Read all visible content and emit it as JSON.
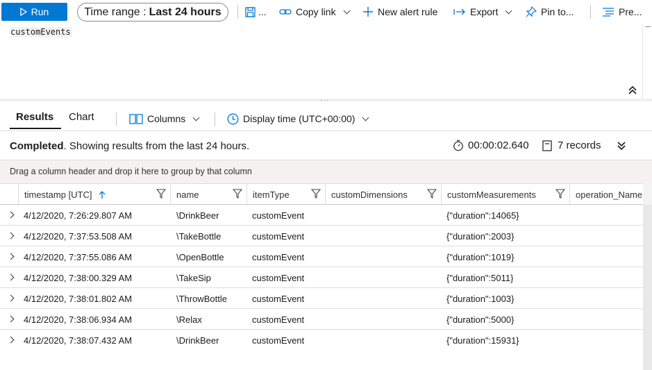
{
  "toolbar": {
    "run_label": "Run",
    "time_range_prefix": "Time range :",
    "time_range_value": "Last 24 hours",
    "save_label": "...",
    "copy_link_label": "Copy link",
    "new_alert_label": "New alert rule",
    "export_label": "Export",
    "pin_label": "Pin to...",
    "prettify_label": "Pre..."
  },
  "editor": {
    "query": "customEvents"
  },
  "results": {
    "tab_results": "Results",
    "tab_chart": "Chart",
    "columns_label": "Columns",
    "display_time_label": "Display time (UTC+00:00)",
    "status_bold": "Completed",
    "status_rest": ". Showing results from the last 24 hours.",
    "duration": "00:00:02.640",
    "records": "7 records",
    "group_hint": "Drag a column header and drop it here to group by that column"
  },
  "grid": {
    "columns": [
      "timestamp [UTC]",
      "name",
      "itemType",
      "customDimensions",
      "customMeasurements",
      "operation_Name"
    ],
    "rows": [
      {
        "timestamp": "4/12/2020, 7:26:29.807 AM",
        "name": "\\DrinkBeer",
        "itemType": "customEvent",
        "customDimensions": "",
        "customMeasurements": "{\"duration\":14065}"
      },
      {
        "timestamp": "4/12/2020, 7:37:53.508 AM",
        "name": "\\TakeBottle",
        "itemType": "customEvent",
        "customDimensions": "",
        "customMeasurements": "{\"duration\":2003}"
      },
      {
        "timestamp": "4/12/2020, 7:37:55.086 AM",
        "name": "\\OpenBottle",
        "itemType": "customEvent",
        "customDimensions": "",
        "customMeasurements": "{\"duration\":1019}"
      },
      {
        "timestamp": "4/12/2020, 7:38:00.329 AM",
        "name": "\\TakeSip",
        "itemType": "customEvent",
        "customDimensions": "",
        "customMeasurements": "{\"duration\":5011}"
      },
      {
        "timestamp": "4/12/2020, 7:38:01.802 AM",
        "name": "\\ThrowBottle",
        "itemType": "customEvent",
        "customDimensions": "",
        "customMeasurements": "{\"duration\":1003}"
      },
      {
        "timestamp": "4/12/2020, 7:38:06.934 AM",
        "name": "\\Relax",
        "itemType": "customEvent",
        "customDimensions": "",
        "customMeasurements": "{\"duration\":5000}"
      },
      {
        "timestamp": "4/12/2020, 7:38:07.432 AM",
        "name": "\\DrinkBeer",
        "itemType": "customEvent",
        "customDimensions": "",
        "customMeasurements": "{\"duration\":15931}"
      }
    ]
  },
  "colors": {
    "accent": "#0078d4",
    "sort_arrow": "#0078d4"
  }
}
